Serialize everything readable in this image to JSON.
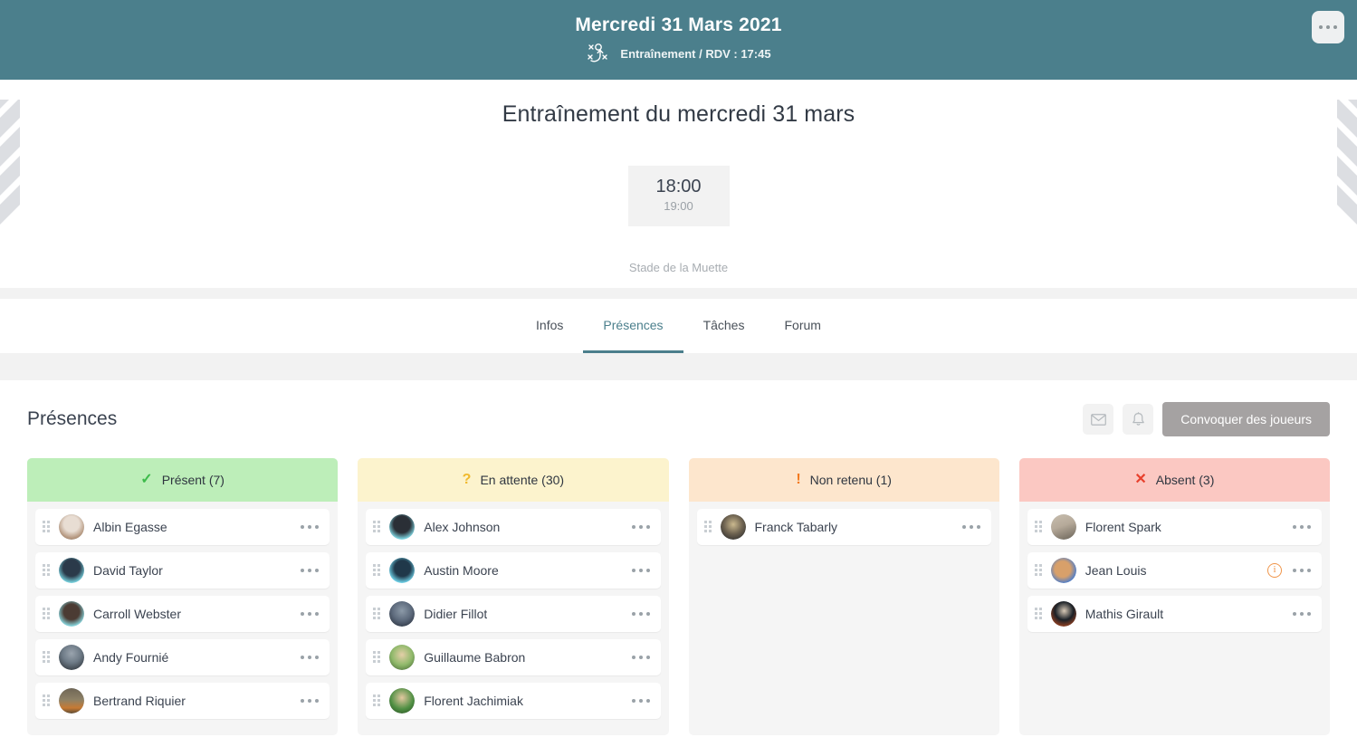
{
  "topbar": {
    "title": "Mercredi 31 Mars 2021",
    "subtitle": "Entraînement / RDV : 17:45",
    "tactics_icon": "tactics-board-icon",
    "menu_icon": "more-options-icon"
  },
  "hero": {
    "event_title": "Entraînement du mercredi 31 mars",
    "time_start": "18:00",
    "time_end": "19:00",
    "venue": "Stade de la Muette"
  },
  "tabs": [
    {
      "label": "Infos",
      "active": false
    },
    {
      "label": "Présences",
      "active": true
    },
    {
      "label": "Tâches",
      "active": false
    },
    {
      "label": "Forum",
      "active": false
    }
  ],
  "content": {
    "section_title": "Présences",
    "mail_icon": "envelope-icon",
    "bell_icon": "bell-icon",
    "primary_button": "Convoquer des joueurs"
  },
  "colors": {
    "brand": "#4b7f8c",
    "present_bg": "#bdeeb9",
    "waiting_bg": "#fcf3cd",
    "notretained_bg": "#fde6cd",
    "absent_bg": "#fbc8c2",
    "check": "#3dbb4b",
    "question": "#f0b92c",
    "exclaim": "#f37a1f",
    "cross": "#e8402c",
    "primary_button": "#a5a2a2"
  },
  "columns": [
    {
      "id": "present",
      "symbol": "✓",
      "symbol_name": "check-icon",
      "symbol_color": "#3dbb4b",
      "label": "Présent (7)",
      "bg": "#bdeeb9",
      "players": [
        {
          "name": "Albin Egasse",
          "avatar_c1": "#e8ddd3",
          "avatar_c2": "#b4967e",
          "flag": false
        },
        {
          "name": "David Taylor",
          "avatar_c1": "#7fe3ef",
          "avatar_c2": "#2b3a4a",
          "flag": false
        },
        {
          "name": "Carroll Webster",
          "avatar_c1": "#8fe6ef",
          "avatar_c2": "#4b3b33",
          "flag": false
        },
        {
          "name": "Andy Fournié",
          "avatar_c1": "#6d7a86",
          "avatar_c2": "#22262b",
          "flag": false
        },
        {
          "name": "Bertrand Riquier",
          "avatar_c1": "#6f6656",
          "avatar_c2": "#c77a33",
          "flag": false
        }
      ]
    },
    {
      "id": "waiting",
      "symbol": "?",
      "symbol_name": "question-icon",
      "symbol_color": "#f0b92c",
      "label": "En attente (30)",
      "bg": "#fcf3cd",
      "players": [
        {
          "name": "Alex Johnson",
          "avatar_c1": "#86e3ef",
          "avatar_c2": "#2a2f36",
          "flag": false
        },
        {
          "name": "Austin Moore",
          "avatar_c1": "#72d9f0",
          "avatar_c2": "#20384a",
          "flag": false
        },
        {
          "name": "Didier Fillot",
          "avatar_c1": "#5d6a7c",
          "avatar_c2": "#1d2430",
          "flag": false
        },
        {
          "name": "Guillaume Babron",
          "avatar_c1": "#8fb96a",
          "avatar_c2": "#3c5c2c",
          "flag": false
        },
        {
          "name": "Florent Jachimiak",
          "avatar_c1": "#4f8f43",
          "avatar_c2": "#26471f",
          "flag": false
        }
      ]
    },
    {
      "id": "not-retained",
      "symbol": "!",
      "symbol_name": "exclamation-icon",
      "symbol_color": "#f37a1f",
      "label": "Non retenu (1)",
      "bg": "#fde6cd",
      "players": [
        {
          "name": "Franck Tabarly",
          "avatar_c1": "#6d6250",
          "avatar_c2": "#1d1f24",
          "flag": false
        }
      ]
    },
    {
      "id": "absent",
      "symbol": "✕",
      "symbol_name": "cross-icon",
      "symbol_color": "#e8402c",
      "label": "Absent (3)",
      "bg": "#fbc8c2",
      "players": [
        {
          "name": "Florent Spark",
          "avatar_c1": "#b6aa9a",
          "avatar_c2": "#6a6358",
          "flag": false
        },
        {
          "name": "Jean Louis",
          "avatar_c1": "#4f7ecb",
          "avatar_c2": "#d8a06a",
          "flag": true,
          "flag_icon": "info-icon"
        },
        {
          "name": "Mathis Girault",
          "avatar_c1": "#e8581f",
          "avatar_c2": "#1b2026",
          "flag": false
        }
      ]
    }
  ]
}
